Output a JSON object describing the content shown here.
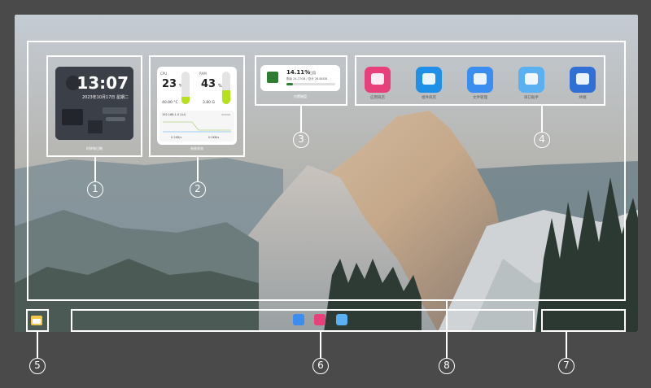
{
  "clock": {
    "time": "13:07",
    "date": "2023年10月17日 星期二",
    "caption": "时钟和日期"
  },
  "system": {
    "cpu_label": "CPU",
    "cpu_value": "23",
    "cpu_unit": "%",
    "cpu_temp": "40.00 °C",
    "ram_label": "RAM",
    "ram_value": "43",
    "ram_unit": "%",
    "ram_size": "3.80 G",
    "ip": "192.168.1.0 (LU)",
    "iface": "enxxx",
    "up_speed": "0.2KB/s",
    "down_speed": "0.0KB/s",
    "caption": "系统状态"
  },
  "storage": {
    "percent": "14.11%",
    "percent_unit": "已用",
    "detail": "剩余 24.77GB / 总计 28.84GB",
    "caption": "内置磁盘",
    "fill": 0.14
  },
  "apps": [
    {
      "label": "应用商店",
      "icon": "store-icon",
      "color": "#e8407a"
    },
    {
      "label": "组件商店",
      "icon": "basket-icon",
      "color": "#1e90e8"
    },
    {
      "label": "文件管理",
      "icon": "folder-icon",
      "color": "#3b8df0"
    },
    {
      "label": "串口助手",
      "icon": "serial-icon",
      "color": "#5ab0f0"
    },
    {
      "label": "终端",
      "icon": "terminal-icon",
      "color": "#2f6fd6"
    }
  ],
  "dock": [
    {
      "icon": "folder-icon",
      "color": "#3b8df0"
    },
    {
      "icon": "store-icon",
      "color": "#e8407a"
    },
    {
      "icon": "serial-icon",
      "color": "#5ab0f0"
    }
  ],
  "callouts": [
    "1",
    "2",
    "3",
    "4",
    "5",
    "6",
    "7",
    "8"
  ]
}
